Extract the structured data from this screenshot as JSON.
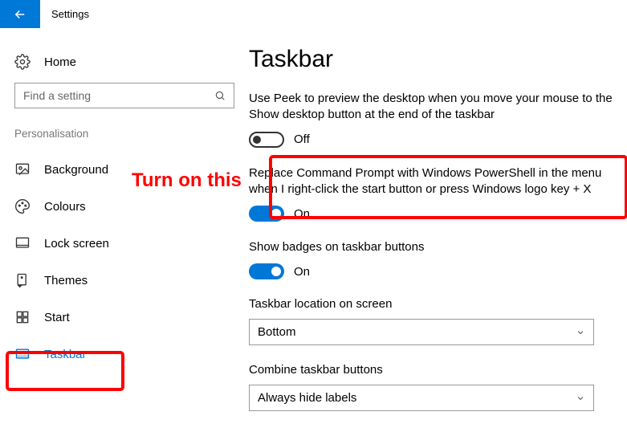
{
  "titlebar": {
    "title": "Settings"
  },
  "sidebar": {
    "home": "Home",
    "search_placeholder": "Find a setting",
    "section": "Personalisation",
    "items": [
      {
        "label": "Background"
      },
      {
        "label": "Colours"
      },
      {
        "label": "Lock screen"
      },
      {
        "label": "Themes"
      },
      {
        "label": "Start"
      },
      {
        "label": "Taskbar"
      }
    ]
  },
  "main": {
    "title": "Taskbar",
    "peek": {
      "desc": "Use Peek to preview the desktop when you move your mouse to the Show desktop button at the end of the taskbar",
      "state": "Off"
    },
    "powershell": {
      "desc": "Replace Command Prompt with Windows PowerShell in the menu when I right-click the start button or press Windows logo key + X",
      "state": "On"
    },
    "badges": {
      "desc": "Show badges on taskbar buttons",
      "state": "On"
    },
    "location": {
      "label": "Taskbar location on screen",
      "value": "Bottom"
    },
    "combine": {
      "label": "Combine taskbar buttons",
      "value": "Always hide labels"
    }
  },
  "annotation": {
    "text": "Turn on this"
  }
}
